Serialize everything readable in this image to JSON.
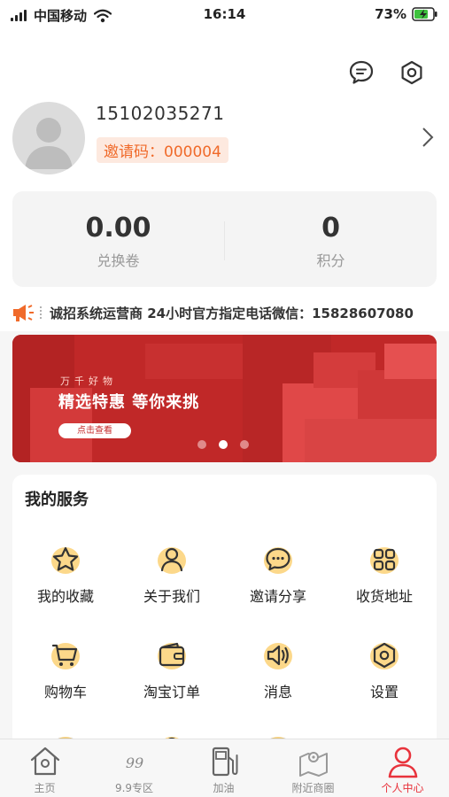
{
  "status_bar": {
    "carrier": "中国移动",
    "time": "16:14",
    "battery": "73%"
  },
  "profile": {
    "phone": "15102035271",
    "invite_code": "邀请码：000004"
  },
  "stats": [
    {
      "value": "0.00",
      "label": "兑换卷"
    },
    {
      "value": "0",
      "label": "积分"
    }
  ],
  "notice": {
    "text": "诚招系统运营商  24小时官方指定电话微信：15828607080"
  },
  "banner": {
    "subtitle": "万千好物",
    "title": "精选特惠 等你来挑",
    "button": "点击查看",
    "slide_count": 3,
    "active_slide": 2
  },
  "services": {
    "title": "我的服务",
    "items": [
      {
        "label": "我的收藏",
        "icon": "star-icon"
      },
      {
        "label": "关于我们",
        "icon": "person-icon"
      },
      {
        "label": "邀请分享",
        "icon": "chat-icon"
      },
      {
        "label": "收货地址",
        "icon": "grid-icon"
      },
      {
        "label": "购物车",
        "icon": "cart-icon"
      },
      {
        "label": "淘宝订单",
        "icon": "wallet-icon"
      },
      {
        "label": "消息",
        "icon": "speaker-icon"
      },
      {
        "label": "设置",
        "icon": "gear-icon"
      }
    ]
  },
  "tabbar": {
    "items": [
      {
        "label": "主页",
        "icon": "home-icon",
        "active": false
      },
      {
        "label": "9.9专区",
        "icon": "nine-nine-icon",
        "active": false
      },
      {
        "label": "加油",
        "icon": "fuel-icon",
        "active": false
      },
      {
        "label": "附近商圈",
        "icon": "map-icon",
        "active": false
      },
      {
        "label": "个人中心",
        "icon": "user-icon",
        "active": true
      }
    ]
  },
  "colors": {
    "accent": "#e8333c",
    "invite_text": "#f06a2a",
    "invite_bg": "#fde9df",
    "banner_red": "#c42a2a",
    "icon_highlight": "#fcd88a"
  }
}
